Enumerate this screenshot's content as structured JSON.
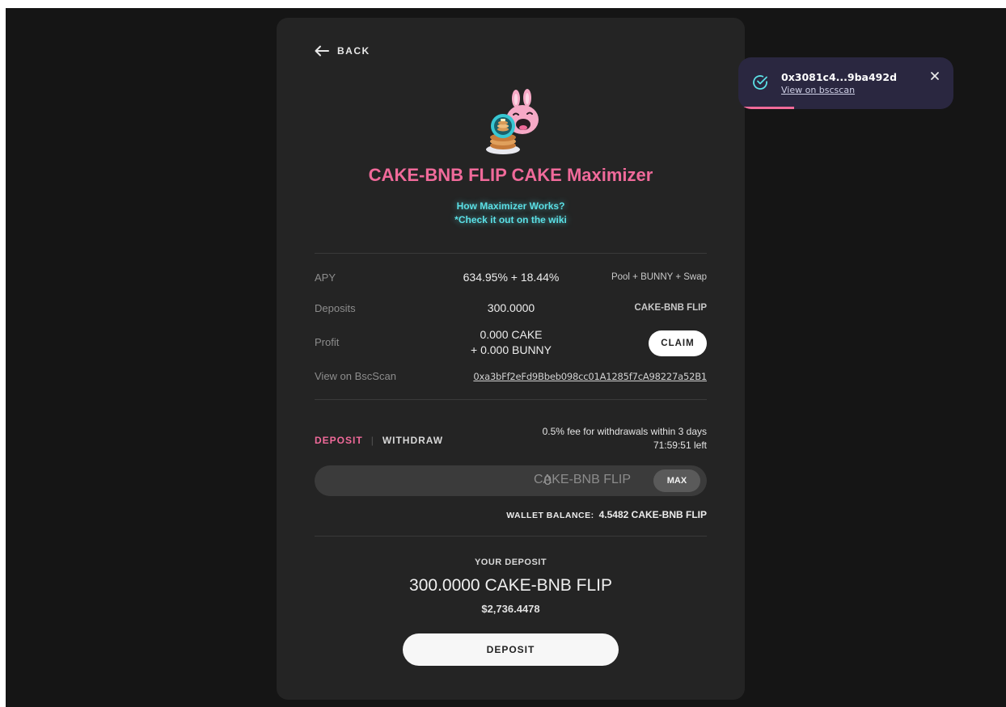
{
  "nav": {
    "back_label": "BACK"
  },
  "vault": {
    "title": "CAKE-BNB FLIP CAKE Maximizer",
    "wiki_line1": "How Maximizer Works?",
    "wiki_line2": "*Check it out on the wiki"
  },
  "stats": {
    "apy_label": "APY",
    "apy_value": "634.95% + 18.44%",
    "apy_note": "Pool + BUNNY + Swap",
    "deposits_label": "Deposits",
    "deposits_value": "300.0000",
    "deposits_note": "CAKE-BNB FLIP",
    "profit_label": "Profit",
    "profit_line1": "0.000 CAKE",
    "profit_line2": "+ 0.000 BUNNY",
    "claim_label": "CLAIM",
    "bscscan_label": "View on BscScan",
    "bscscan_address": "0xa3bFf2eFd9Bbeb098cc01A1285f7cA98227a52B1"
  },
  "action": {
    "tab_deposit": "DEPOSIT",
    "tab_withdraw": "WITHDRAW",
    "fee_line1": "0.5% fee for withdrawals within 3 days",
    "fee_line2": "71:59:51 left",
    "amount_value": "0",
    "amount_unit": "CAKE-BNB FLIP",
    "max_label": "MAX",
    "wallet_label": "WALLET BALANCE:",
    "wallet_value": "4.5482 CAKE-BNB FLIP"
  },
  "summary": {
    "your_deposit_label": "YOUR DEPOSIT",
    "your_deposit_amount": "300.0000 CAKE-BNB FLIP",
    "your_deposit_usd": "$2,736.4478",
    "deposit_button": "DEPOSIT"
  },
  "toast": {
    "hash": "0x3081c4...9ba492d",
    "link_label": "View on bscscan",
    "progress": 0.26
  },
  "colors": {
    "accent_pink": "#f06a9a",
    "accent_cyan": "#5be0e6",
    "card_bg": "#242424",
    "page_bg": "#151515",
    "toast_bg": "#2a2740"
  }
}
